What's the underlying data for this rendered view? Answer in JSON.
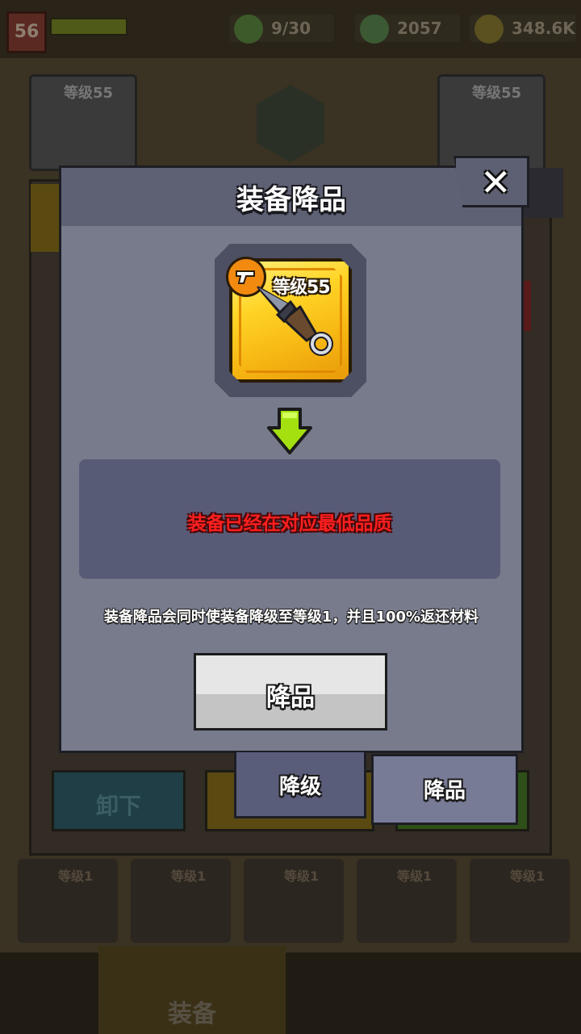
{
  "background": {
    "player_level": "56",
    "resources": [
      {
        "name": "energy",
        "value": "9/30",
        "icon": "energy-icon"
      },
      {
        "name": "gems",
        "value": "2057",
        "icon": "gem-icon"
      },
      {
        "name": "coins",
        "value": "348.6K",
        "icon": "coin-icon"
      }
    ],
    "slot_left_level": "等级55",
    "slot_right_level": "等级55",
    "unload_label": "卸下",
    "inventory_levels": [
      "等级1",
      "等级1",
      "等级1",
      "等级1",
      "等级1"
    ],
    "nav_active_label": "装备"
  },
  "dialog": {
    "title": "装备降品",
    "item": {
      "level_label": "等级55",
      "icon": "kunai-icon",
      "type_icon": "weapon-type-icon",
      "rarity_color": "#ffd426"
    },
    "message": "装备已经在对应最低品质",
    "info": "装备降品会同时使装备降级至等级1，并且100%返还材料",
    "confirm_label": "降品",
    "close_icon": "close-icon"
  },
  "tabs": [
    {
      "label": "降级"
    },
    {
      "label": "降品"
    }
  ],
  "colors": {
    "dialog_bg": "#777b8c",
    "header_bg": "#5e6174",
    "message_red": "#ff1f1f",
    "arrow_green": "#a4e010"
  }
}
